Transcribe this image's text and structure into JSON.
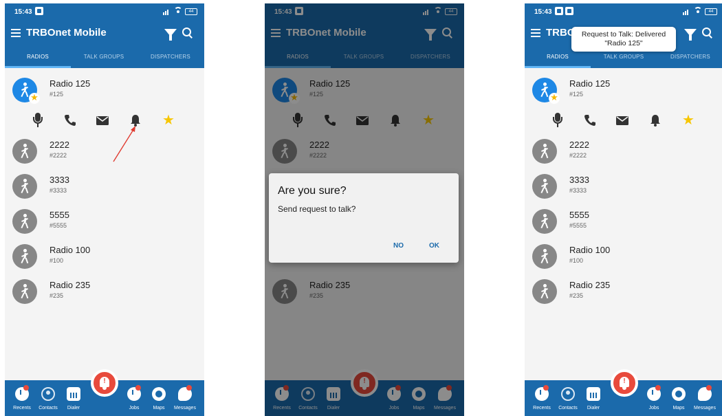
{
  "status_bar": {
    "time": "15:43",
    "battery": "44"
  },
  "app_bar": {
    "title": "TRBOnet Mobile",
    "title_truncated": "TRBO"
  },
  "tabs": [
    {
      "label": "RADIOS",
      "active": true
    },
    {
      "label": "TALK GROUPS",
      "active": false
    },
    {
      "label": "DISPATCHERS",
      "active": false
    }
  ],
  "radios": [
    {
      "name": "Radio 125",
      "id": "#125",
      "favorite": true,
      "selected": true
    },
    {
      "name": "2222",
      "id": "#2222"
    },
    {
      "name": "3333",
      "id": "#3333"
    },
    {
      "name": "5555",
      "id": "#5555"
    },
    {
      "name": "Radio 100",
      "id": "#100"
    },
    {
      "name": "Radio 235",
      "id": "#235"
    }
  ],
  "actions": [
    "microphone-icon",
    "phone-icon",
    "envelope-icon",
    "bell-icon",
    "star-icon"
  ],
  "bottom_nav": [
    {
      "label": "Recents",
      "icon": "recents-icon"
    },
    {
      "label": "Contacts",
      "icon": "contacts-icon"
    },
    {
      "label": "Dialer",
      "icon": "dialer-icon"
    },
    {
      "label": "Jobs",
      "icon": "jobs-icon"
    },
    {
      "label": "Maps",
      "icon": "maps-icon"
    },
    {
      "label": "Messages",
      "icon": "messages-icon"
    }
  ],
  "dialog": {
    "title": "Are you sure?",
    "message": "Send request to talk?",
    "no_label": "NO",
    "ok_label": "OK"
  },
  "toast": {
    "line1": "Request to Talk: Delivered",
    "line2": "\"Radio 125\""
  },
  "colors": {
    "primary": "#1b6aab",
    "accent_tab": "#61b5f5",
    "alert": "#e84a3c",
    "favorite": "#f7c600",
    "avatar_gray": "#878787",
    "avatar_selected": "#1e88e5"
  }
}
